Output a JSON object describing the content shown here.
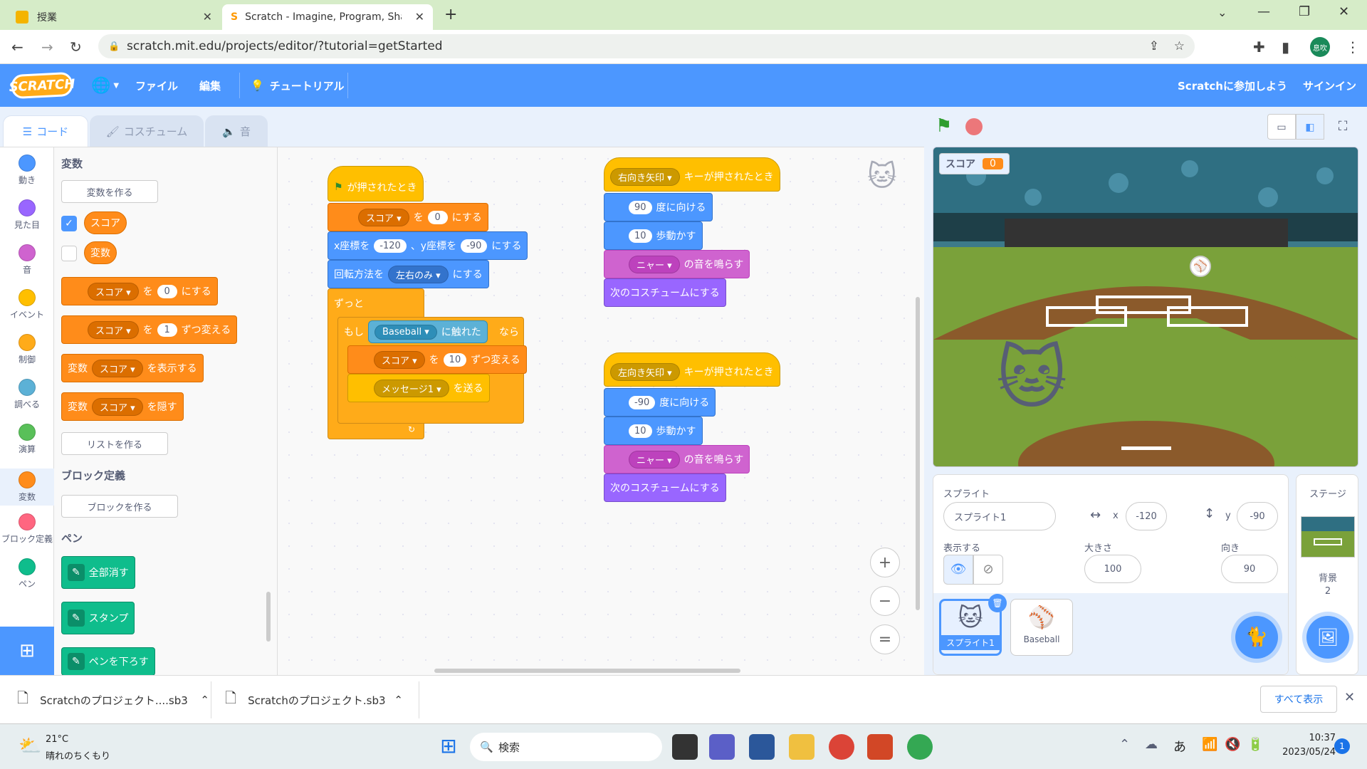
{
  "browser": {
    "tabs": [
      {
        "label": "授業"
      },
      {
        "label": "Scratch - Imagine, Program, Shar"
      }
    ],
    "url": "scratch.mit.edu/projects/editor/?tutorial=getStarted",
    "profile": "息吹"
  },
  "menubar": {
    "logo": "SCRATCH",
    "file": "ファイル",
    "edit": "編集",
    "tutorial": "チュートリアル",
    "join": "Scratchに参加しよう",
    "signin": "サインイン"
  },
  "editor_tabs": {
    "code": "コード",
    "costume": "コスチューム",
    "sound": "音"
  },
  "categories": [
    {
      "label": "動き",
      "color": "#4c97ff"
    },
    {
      "label": "見た目",
      "color": "#9966ff"
    },
    {
      "label": "音",
      "color": "#cf63cf"
    },
    {
      "label": "イベント",
      "color": "#ffbf00"
    },
    {
      "label": "制御",
      "color": "#ffab19"
    },
    {
      "label": "調べる",
      "color": "#5cb1d6"
    },
    {
      "label": "演算",
      "color": "#59c059"
    },
    {
      "label": "変数",
      "color": "#ff8c1a"
    },
    {
      "label": "ブロック定義",
      "color": "#ff6680"
    },
    {
      "label": "ペン",
      "color": "#0fbd8c"
    }
  ],
  "palette": {
    "var_title": "変数",
    "make_var": "変数を作る",
    "var_score": "スコア",
    "var_hensu": "変数",
    "set_block": {
      "dd": "スコア",
      "to": "を",
      "val": "0",
      "end": "にする"
    },
    "change_block": {
      "dd": "スコア",
      "to": "を",
      "val": "1",
      "end": "ずつ変える"
    },
    "show_block": {
      "pre": "変数",
      "dd": "スコア",
      "end": "を表示する"
    },
    "hide_block": {
      "pre": "変数",
      "dd": "スコア",
      "end": "を隠す"
    },
    "make_list": "リストを作る",
    "myblocks_title": "ブロック定義",
    "make_block": "ブロックを作る",
    "pen_title": "ペン",
    "pen_clear": "全部消す",
    "pen_stamp": "スタンプ",
    "pen_down": "ペンを下ろす"
  },
  "scripts": {
    "s1": {
      "hat": "が押されたとき",
      "set_dd": "スコア",
      "set_to": "を",
      "set_val": "0",
      "set_end": "にする",
      "goto_x": "x座標を",
      "goto_xv": "-120",
      "goto_y": "、y座標を",
      "goto_yv": "-90",
      "goto_end": "にする",
      "rot_pre": "回転方法を",
      "rot_dd": "左右のみ",
      "rot_end": "にする",
      "forever": "ずっと",
      "if": "もし",
      "touch_dd": "Baseball",
      "touch_end": "に触れた",
      "then": "なら",
      "chg_dd": "スコア",
      "chg_to": "を",
      "chg_val": "10",
      "chg_end": "ずつ変える",
      "bc_dd": "メッセージ1",
      "bc_end": "を送る"
    },
    "s2": {
      "key_dd": "右向き矢印",
      "hat_end": "キーが押されたとき",
      "dir": "90",
      "dir_end": "度に向ける",
      "move": "10",
      "move_end": "歩動かす",
      "snd_dd": "ニャー",
      "snd_end": "の音を鳴らす",
      "next": "次のコスチュームにする"
    },
    "s3": {
      "key_dd": "左向き矢印",
      "hat_end": "キーが押されたとき",
      "dir": "-90",
      "dir_end": "度に向ける",
      "move": "10",
      "move_end": "歩動かす",
      "snd_dd": "ニャー",
      "snd_end": "の音を鳴らす",
      "next": "次のコスチュームにする"
    }
  },
  "stage": {
    "monitor_label": "スコア",
    "monitor_value": "0"
  },
  "sprite_info": {
    "title": "スプライト",
    "name": "スプライト1",
    "x_label": "x",
    "x": "-120",
    "y_label": "y",
    "y": "-90",
    "show_label": "表示する",
    "size_label": "大きさ",
    "size": "100",
    "dir_label": "向き",
    "dir": "90"
  },
  "sprites": [
    {
      "name": "スプライト1"
    },
    {
      "name": "Baseball"
    }
  ],
  "stage_pane": {
    "title": "ステージ",
    "bg_label": "背景",
    "bg_count": "2"
  },
  "downloads": {
    "file1": "Scratchのプロジェクト....sb3",
    "file2": "Scratchのプロジェクト.sb3",
    "show_all": "すべて表示"
  },
  "taskbar": {
    "temp": "21°C",
    "weather": "晴れのちくもり",
    "search": "検索",
    "time": "10:37",
    "date": "2023/05/24",
    "ime": "あ",
    "badge": "1"
  }
}
